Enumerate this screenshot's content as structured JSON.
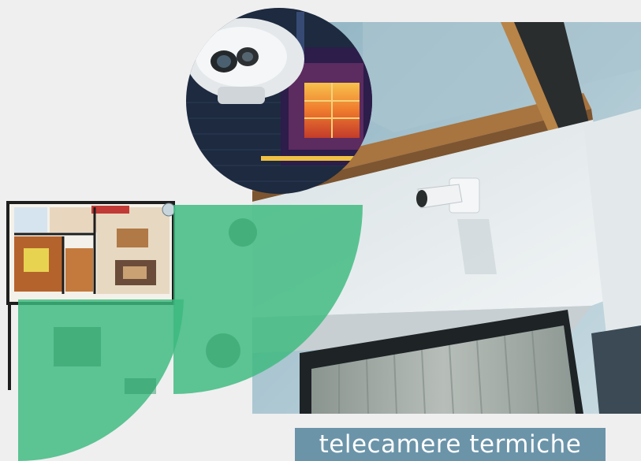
{
  "caption": {
    "text": "telecamere termiche"
  },
  "colors": {
    "background": "#efeff0",
    "coverage_green": "#3cba7e",
    "caption_bg": "#6b94a9",
    "caption_text": "#ffffff",
    "wall_white": "#e6ebed",
    "wood_beam": "#a8743f",
    "dark_beam": "#2a2d2e",
    "thermal_hot": "#f2a63a"
  },
  "images": {
    "house_photo": "house-facade-with-camera-photo",
    "thermal_inset": "thermal-camera-inset",
    "floor_plan": "floor-plan-with-coverage"
  }
}
